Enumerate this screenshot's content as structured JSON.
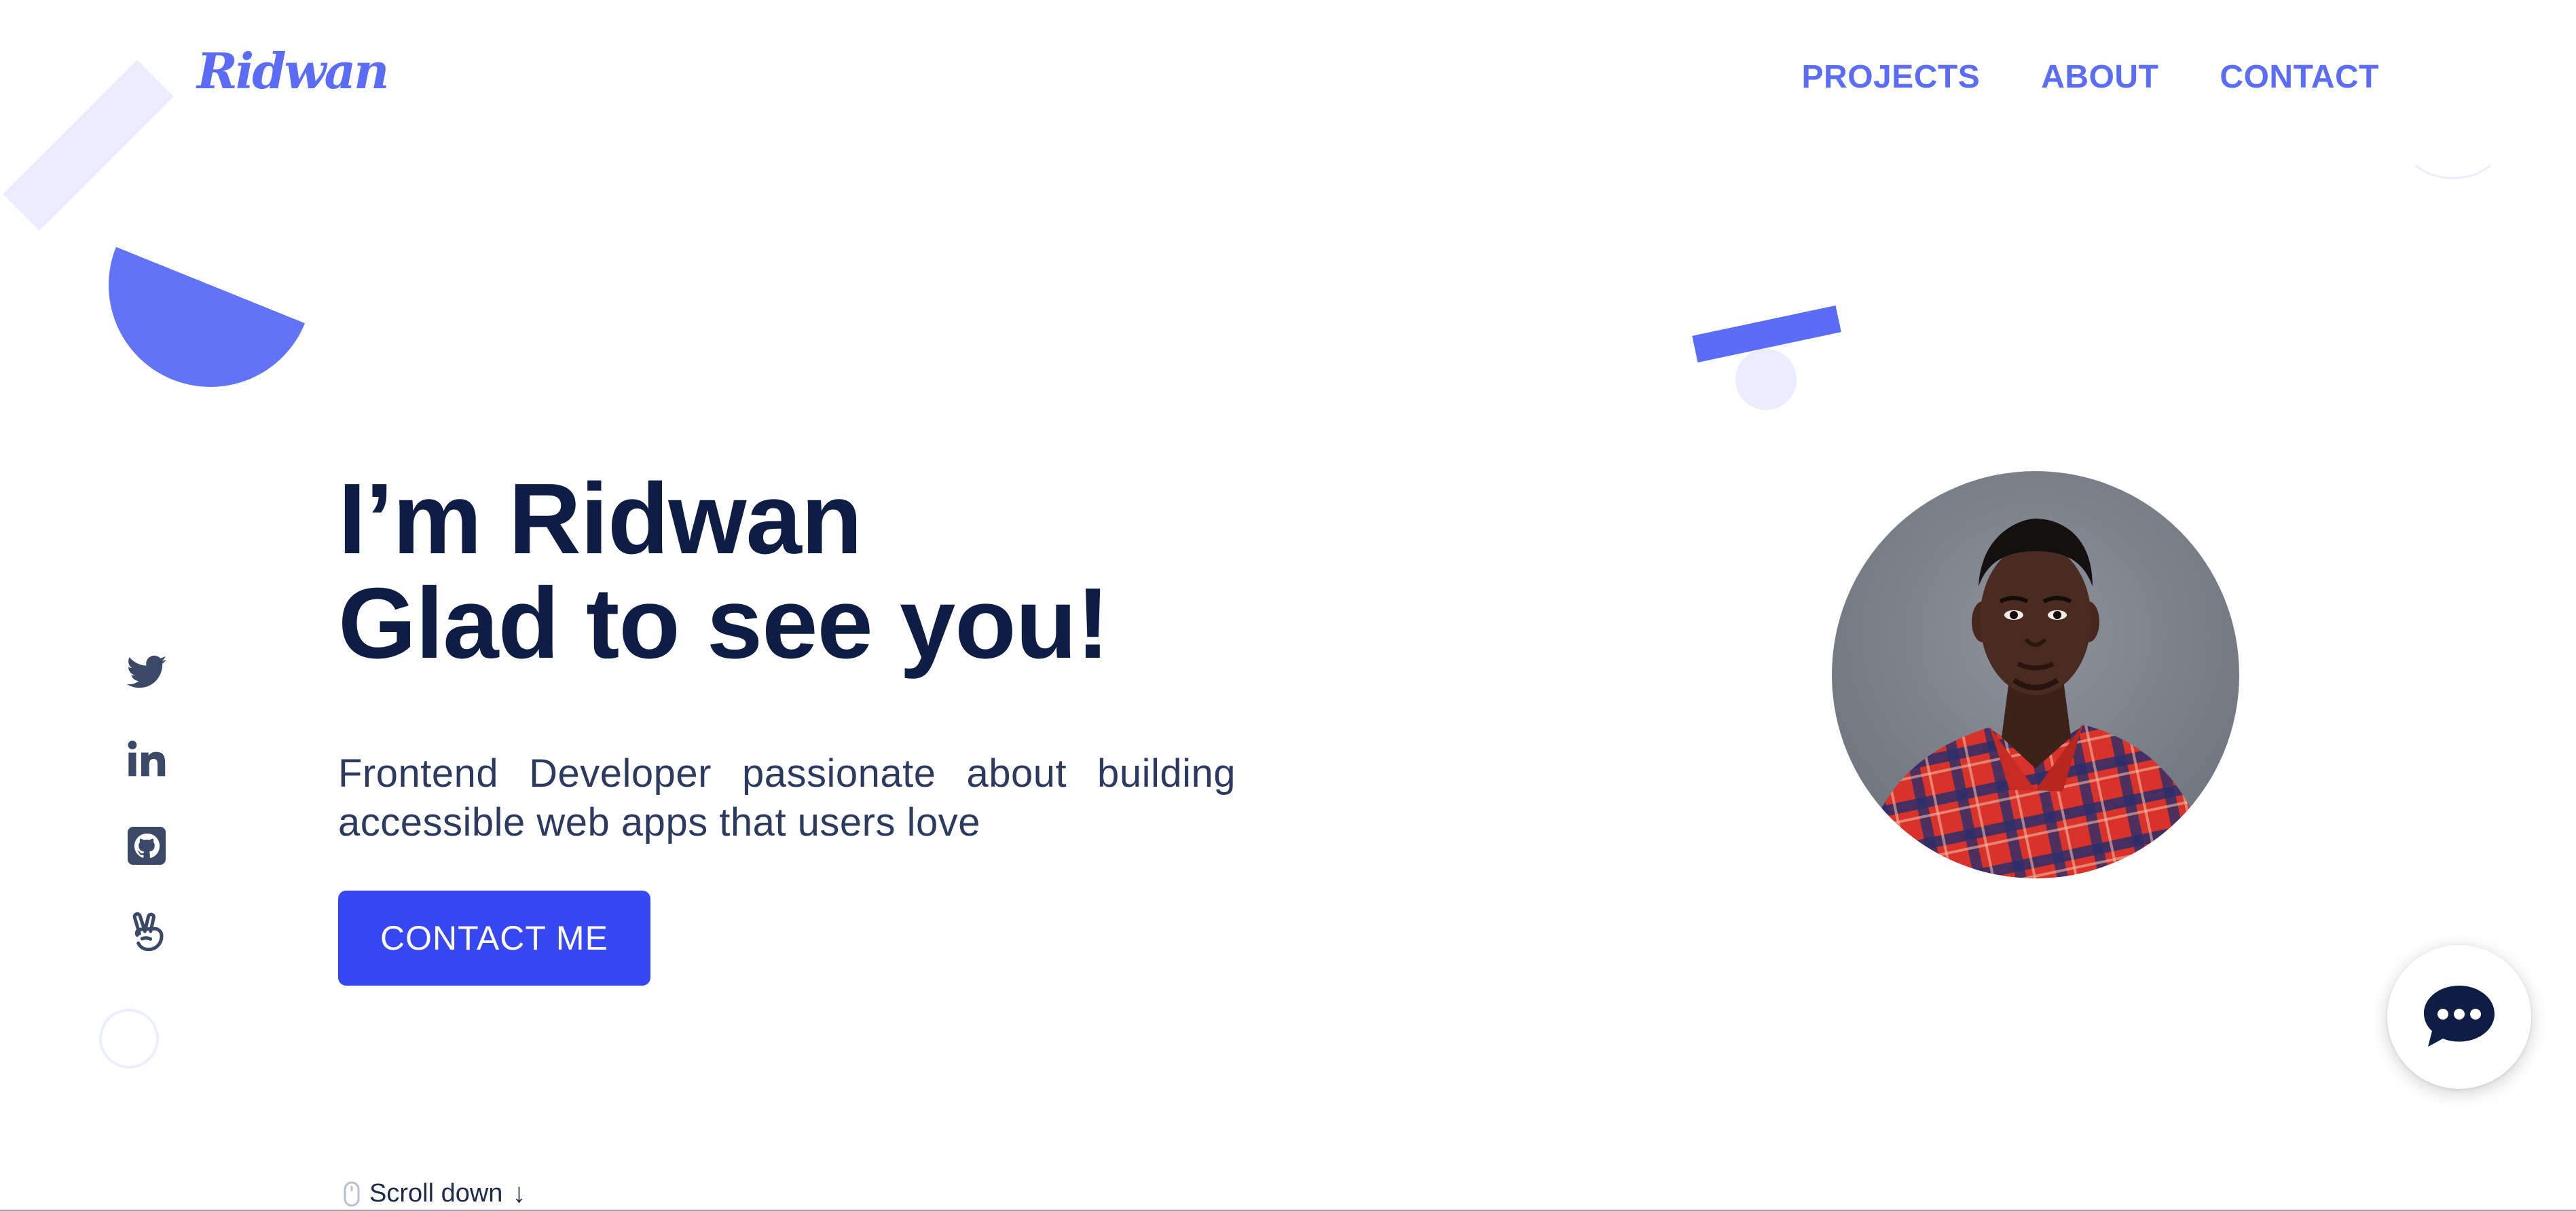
{
  "header": {
    "logo_text": "Ridwan",
    "nav": [
      {
        "label": "PROJECTS"
      },
      {
        "label": "ABOUT"
      },
      {
        "label": "CONTACT"
      }
    ]
  },
  "socials": [
    {
      "icon": "twitter-icon"
    },
    {
      "icon": "linkedin-icon"
    },
    {
      "icon": "github-icon"
    },
    {
      "icon": "peace-hand-icon"
    }
  ],
  "hero": {
    "title_line1": "I’m Ridwan",
    "title_line2": "Glad to see you!",
    "description": "Frontend Developer passionate about building accessible web apps that users love",
    "cta_label": "CONTACT ME"
  },
  "scroll_hint": {
    "label": "Scroll down",
    "arrow": "↓"
  },
  "colors": {
    "accent": "#5b6cf6",
    "button": "#3747f3",
    "heading": "#0e1d44",
    "body_text": "#2c3a60",
    "shape_light": "#ebecfe"
  }
}
